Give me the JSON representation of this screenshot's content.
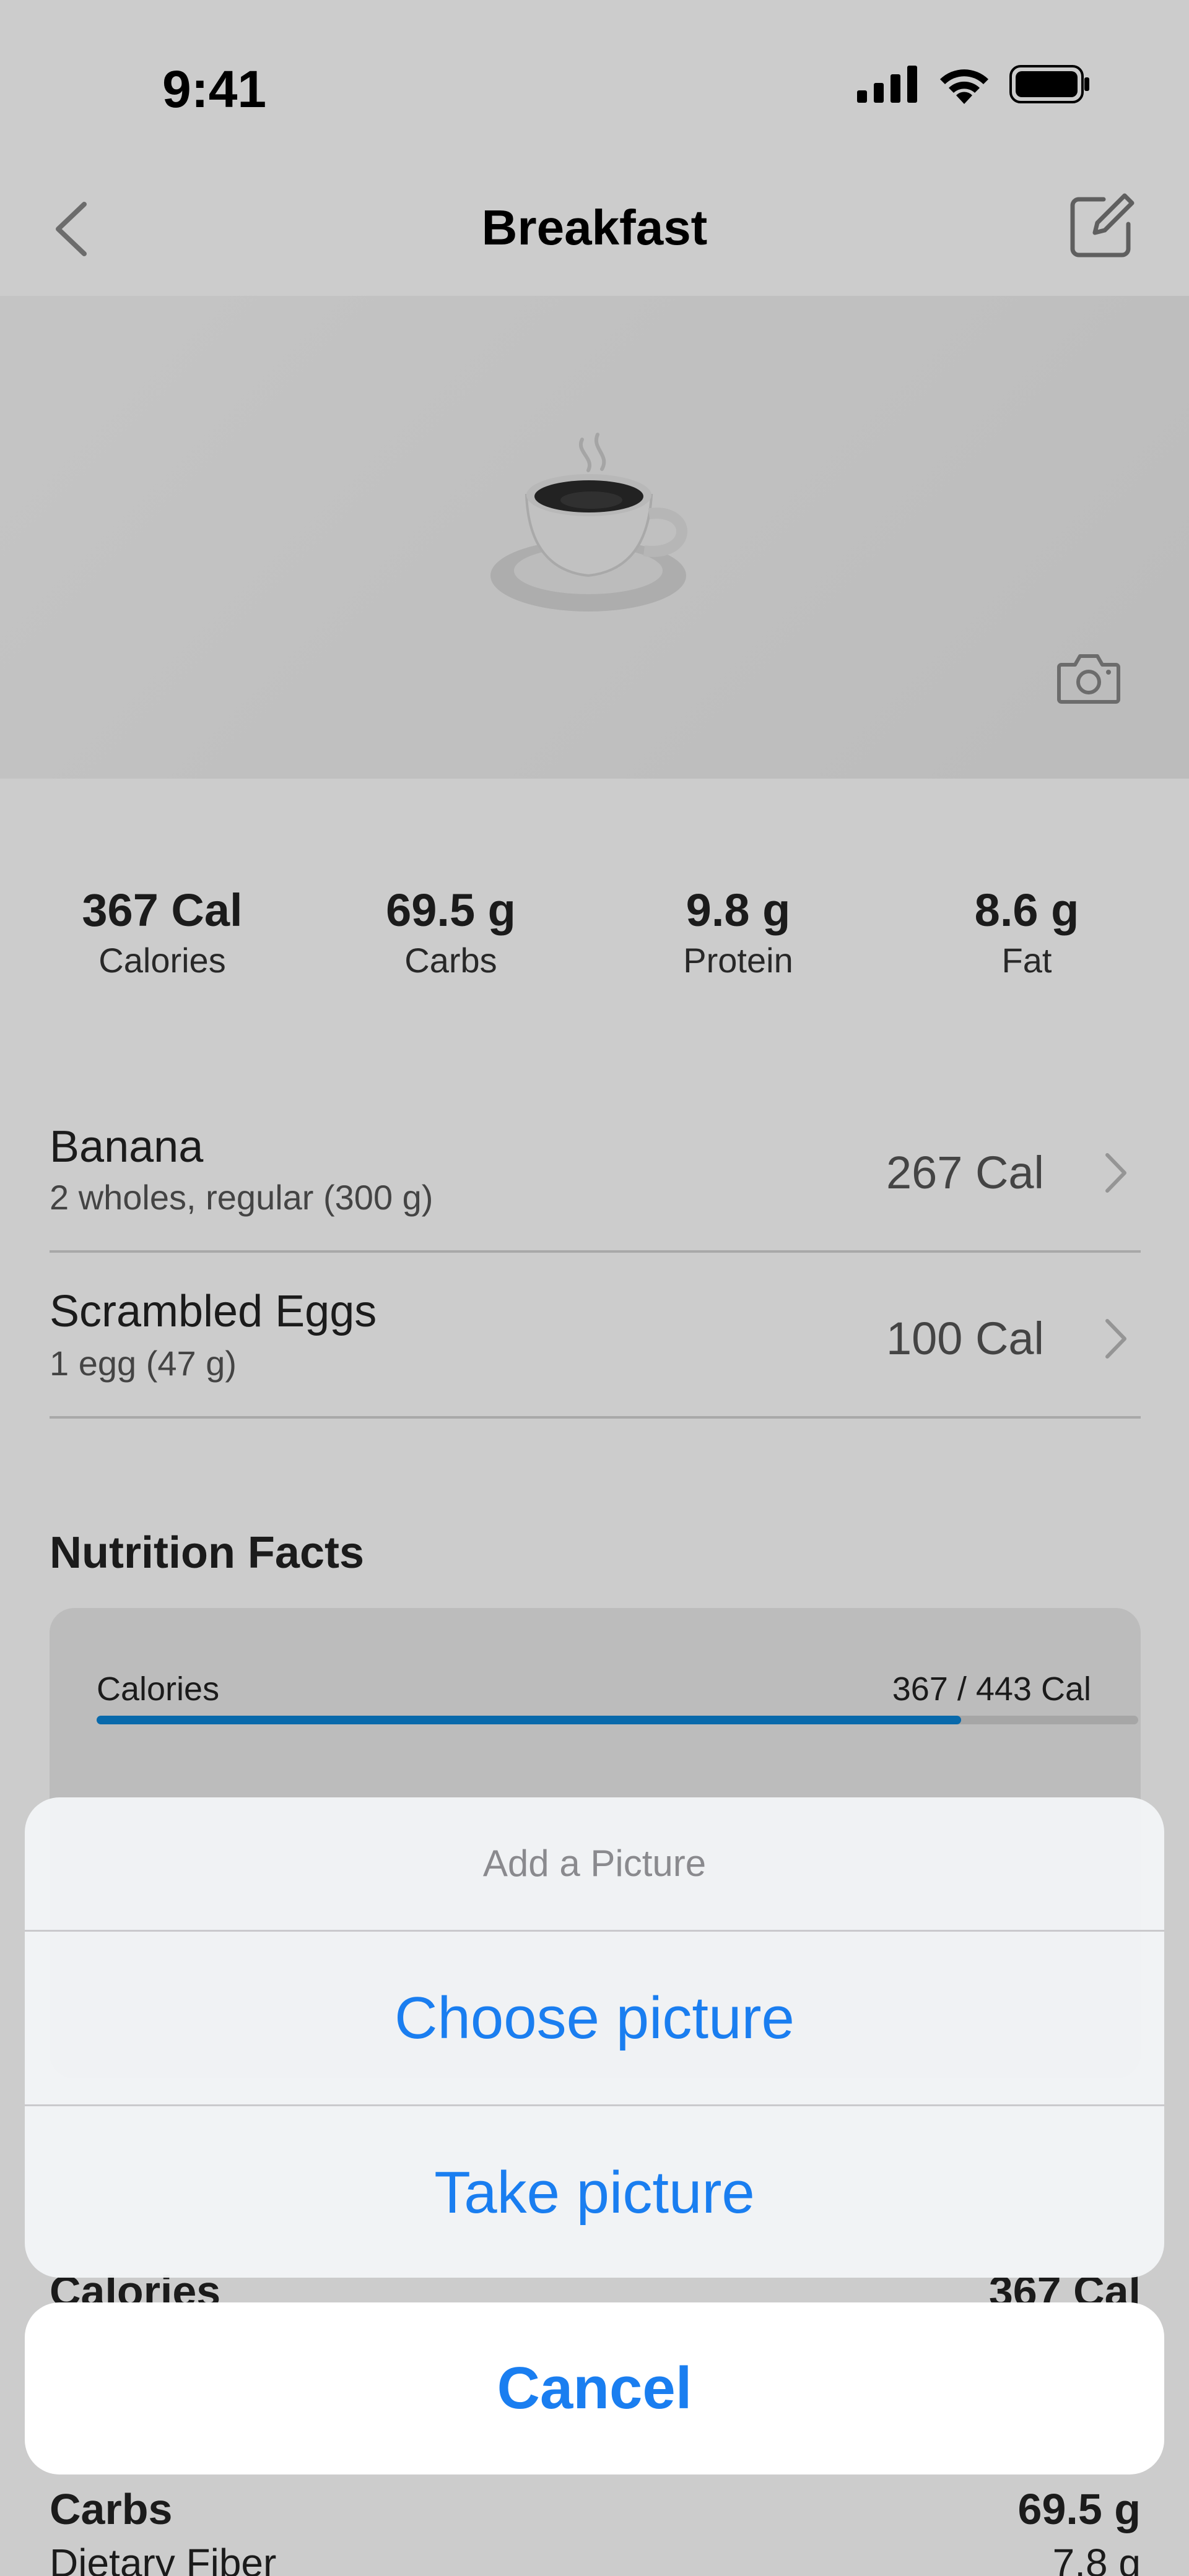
{
  "status_bar": {
    "time": "9:41"
  },
  "nav": {
    "title": "Breakfast"
  },
  "hero": {
    "image_icon": "coffee-cup-icon",
    "camera_icon": "camera-icon"
  },
  "macros": [
    {
      "value": "367 Cal",
      "label": "Calories"
    },
    {
      "value": "69.5 g",
      "label": "Carbs"
    },
    {
      "value": "9.8 g",
      "label": "Protein"
    },
    {
      "value": "8.6 g",
      "label": "Fat"
    }
  ],
  "foods": [
    {
      "name": "Banana",
      "serving": "2 wholes, regular (300 g)",
      "calories": "267 Cal"
    },
    {
      "name": "Scrambled Eggs",
      "serving": "1 egg (47 g)",
      "calories": "100 Cal"
    }
  ],
  "nutrition": {
    "title": "Nutrition Facts",
    "calories_label": "Calories",
    "calories_value": "367 / 443 Cal",
    "calories_progress": 0.83,
    "summary_label": "Calories",
    "summary_value": "367 Cal",
    "carbs_label": "Carbs",
    "carbs_value": "69.5 g",
    "fiber_label": "Dietary Fiber",
    "fiber_value": "7.8 g"
  },
  "action_sheet": {
    "title": "Add a Picture",
    "choose": "Choose picture",
    "take": "Take picture",
    "cancel": "Cancel"
  },
  "colors": {
    "accent": "#1a7ef0",
    "progress": "#0a84d6"
  }
}
